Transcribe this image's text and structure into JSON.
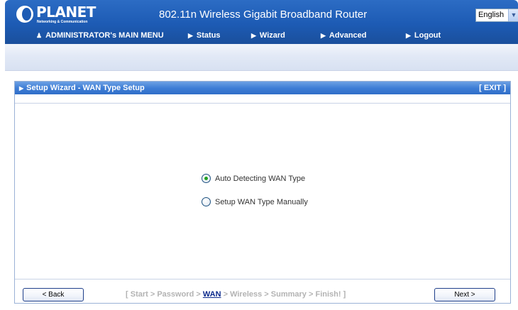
{
  "header": {
    "logo_name": "PLANET",
    "logo_tagline": "Networking & Communication",
    "title": "802.11n Wireless Gigabit Broadband Router",
    "language": "English"
  },
  "menu": {
    "items": [
      {
        "label": "ADMINISTRATOR's MAIN MENU",
        "icon": "user-icon"
      },
      {
        "label": "Status",
        "icon": "arrow-right-icon"
      },
      {
        "label": "Wizard",
        "icon": "arrow-right-icon"
      },
      {
        "label": "Advanced",
        "icon": "arrow-right-icon"
      },
      {
        "label": "Logout",
        "icon": "arrow-right-icon"
      }
    ]
  },
  "panel": {
    "title": "Setup Wizard - WAN Type Setup",
    "exit_label": "[ EXIT ]",
    "options": [
      {
        "label": "Auto Detecting WAN Type",
        "checked": true
      },
      {
        "label": "Setup WAN Type Manually",
        "checked": false
      }
    ]
  },
  "wizard_nav": {
    "back_label": "< Back",
    "next_label": "Next >",
    "open_bracket": "[ ",
    "close_bracket": " ]",
    "separator": " > ",
    "steps": [
      "Start",
      "Password",
      "WAN",
      "Wireless",
      "Summary",
      "Finish!"
    ],
    "current_step": "WAN"
  },
  "colors": {
    "header_blue": "#1d5bb4",
    "panel_title_blue": "#3f7ed6",
    "current_step": "#0b2a8c",
    "inactive_step": "#b3b3b3",
    "radio_selected": "#21a121"
  }
}
